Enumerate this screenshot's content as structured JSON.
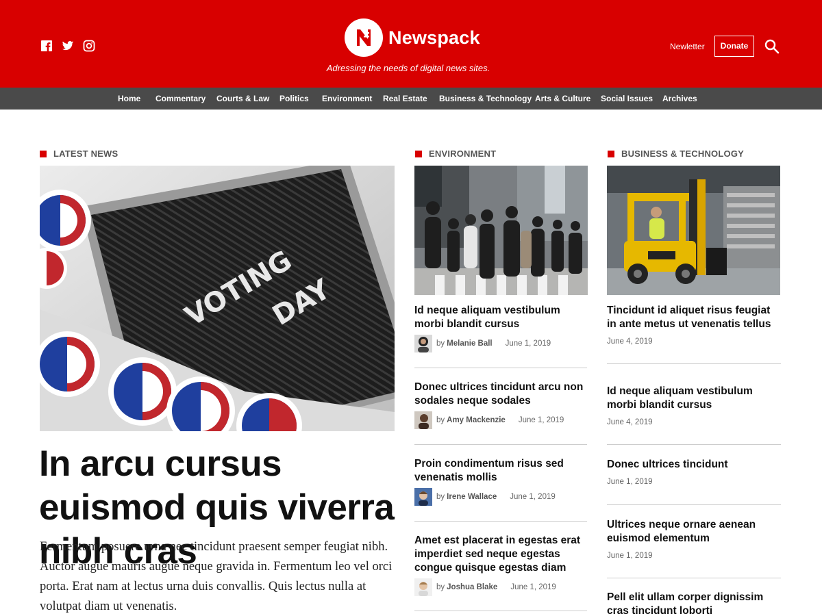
{
  "site": {
    "name": "Newspack",
    "tagline": "Adressing the needs of digital news sites.",
    "brand_color": "#d80000"
  },
  "header": {
    "social_icons": [
      "facebook-icon",
      "twitter-icon",
      "instagram-icon"
    ],
    "newsletter_label": "Newletter",
    "donate_label": "Donate",
    "search_icon": "search-icon"
  },
  "nav": {
    "items": [
      "Home",
      "Commentary",
      "Courts & Law",
      "Politics",
      "Environment",
      "Real Estate",
      "Business & Technology",
      "Arts & Culture",
      "Social Issues",
      "Archives"
    ]
  },
  "latest": {
    "heading": "Latest News",
    "image": "voting-day-letterboard-and-voted-stickers",
    "title": "In arcu cursus euismod quis viverra nibh cras",
    "excerpt": "Fermentum posuere urna nec tincidunt praesent semper feugiat nibh. Auctor augue mauris augue neque gravida in. Fermentum leo vel orci porta. Erat nam at lectus urna duis convallis. Quis lectus nulla at volutpat diam ut venenatis."
  },
  "environment": {
    "heading": "Environment",
    "image": "pedestrians-crossing-city-street",
    "stories": [
      {
        "title": "Id neque aliquam vestibulum morbi blandit cursus",
        "by": "by",
        "author": "Melanie Ball",
        "date": "June 1, 2019"
      },
      {
        "title": "Donec ultrices tincidunt arcu non sodales neque sodales",
        "by": "by",
        "author": "Amy Mackenzie",
        "date": "June 1, 2019"
      },
      {
        "title": "Proin condimentum risus sed venenatis mollis",
        "by": "by",
        "author": "Irene Wallace",
        "date": "June 1, 2019"
      },
      {
        "title": "Amet est placerat in egestas erat imperdiet sed neque egestas congue quisque egestas diam",
        "by": "by",
        "author": "Joshua Blake",
        "date": "June 1, 2019"
      }
    ]
  },
  "business": {
    "heading": "Business & Technology",
    "image": "forklift-in-warehouse",
    "stories": [
      {
        "title": "Tincidunt id aliquet risus feugiat in ante metus ut venenatis tellus",
        "date": "June 4, 2019"
      },
      {
        "title": "Id neque aliquam vestibulum morbi blandit cursus",
        "date": "June 4, 2019"
      },
      {
        "title": "Donec ultrices tincidunt",
        "date": "June 1, 2019"
      },
      {
        "title": "Ultrices neque ornare aenean euismod elementum",
        "date": "June 1, 2019"
      },
      {
        "title": "Pell elit ullam corper dignissim cras tincidunt loborti",
        "date": ""
      }
    ]
  }
}
